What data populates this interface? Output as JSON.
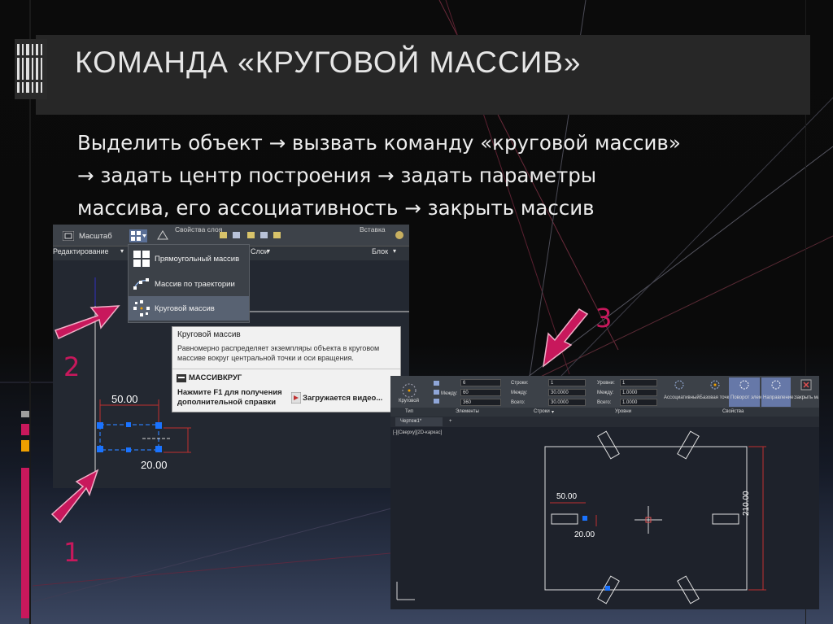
{
  "slide": {
    "title": "КОМАНДА «КРУГОВОЙ МАССИВ»",
    "body_lines": [
      "Выделить объект → вызвать команду «круговой массив»",
      "→ задать центр построения → задать параметры",
      "массива, его ассоциативность → закрыть массив"
    ],
    "step_numbers": [
      "1",
      "2",
      "3"
    ],
    "accent_color": "#c8185c",
    "strip_colors": [
      "#9e9e9e",
      "#c8185c",
      "#f0a000",
      "#c8185c"
    ]
  },
  "left_screenshot": {
    "ribbon": {
      "scale_button": "Масштаб",
      "layer_properties": "Свойства слоя",
      "insert": "Вставка",
      "edit_panel": "Редактирование",
      "layers_panel": "Слои",
      "block_panel": "Блок"
    },
    "array_menu": {
      "items": [
        "Прямоугольный массив",
        "Массив по траектории",
        "Круговой массив"
      ],
      "selected_index": 2
    },
    "tooltip": {
      "title": "Круговой массив",
      "description": "Равномерно распределяет экземпляры объекта в круговом массиве вокруг центральной точки и оси вращения.",
      "command": "МАССИВКРУГ",
      "help": "Нажмите F1 для получения дополнительной справки",
      "video": "Загружается видео..."
    },
    "dimensions": {
      "width": "50.00",
      "height": "20.00"
    }
  },
  "right_screenshot": {
    "ribbon": {
      "type_label": "Тип",
      "type_value": "Круговой",
      "elements_label": "Элементы",
      "rows_label": "Строки",
      "levels_label": "Уровни",
      "properties_label": "Свойства",
      "between_label": "Между:",
      "total_label": "Всего:",
      "rows_field": "Строки:",
      "level_field": "Уровни:",
      "fields": {
        "elem_count": "6",
        "elem_between": "60",
        "elem_total": "360",
        "rows_count": "1",
        "rows_between": "30.0000",
        "rows_total": "30.0000",
        "lev_count": "1",
        "lev_between": "1.0000",
        "lev_total": "1.0000"
      },
      "assoc_btn": "Ассоциативный",
      "base_btn": "Базовая точка",
      "rotate_btn": "Поворот элементов",
      "direction_btn": "Направление",
      "close_btn": "Закрыть массив"
    },
    "tab": {
      "name": "Чертеж1*",
      "plus": "+"
    },
    "view_label": "[-][Сверху][2D-каркас]",
    "dimensions": {
      "width": "50.00",
      "height": "20.00",
      "overall": "210.00"
    }
  }
}
